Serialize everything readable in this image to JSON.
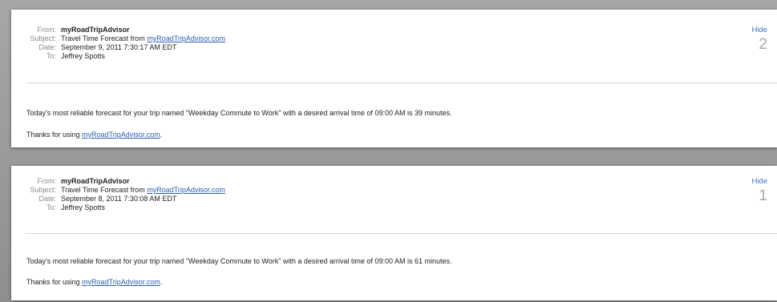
{
  "messages": [
    {
      "from_label": "From:",
      "from": "myRoadTripAdvisor",
      "subject_label": "Subject:",
      "subject_prefix": "Travel Time Forecast from ",
      "subject_link": "myRoadTripAdvisor.com",
      "date_label": "Date:",
      "date": "September 9, 2011 7:30:17 AM EDT",
      "to_label": "To:",
      "to": "Jeffrey Spotts",
      "hide": "Hide",
      "number": "2",
      "body": "Today's most reliable forecast for your trip named \"Weekday Commute to Work\" with a desired arrival time of 09:00 AM is 39 minutes.",
      "thanks_prefix": "Thanks for using ",
      "thanks_link": "myRoadTripAdvisor.com",
      "thanks_suffix": "."
    },
    {
      "from_label": "From:",
      "from": "myRoadTripAdvisor",
      "subject_label": "Subject:",
      "subject_prefix": "Travel Time Forecast from ",
      "subject_link": "myRoadTripAdvisor.com",
      "date_label": "Date:",
      "date": "September 8, 2011 7:30:08 AM EDT",
      "to_label": "To:",
      "to": "Jeffrey Spotts",
      "hide": "Hide",
      "number": "1",
      "body": "Today's most reliable forecast for your trip named \"Weekday Commute to Work\" with a desired arrival time of 09:00 AM is 61 minutes.",
      "thanks_prefix": "Thanks for using ",
      "thanks_link": "myRoadTripAdvisor.com",
      "thanks_suffix": "."
    }
  ]
}
